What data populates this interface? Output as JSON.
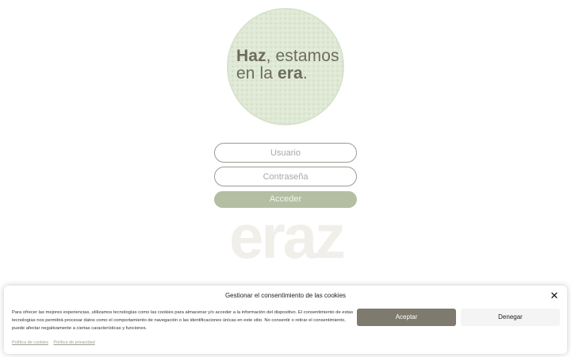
{
  "hero": {
    "line1_bold": "Haz",
    "line1_rest": ", estamos",
    "line2_start": "en la ",
    "line2_bold": "era",
    "line2_end": "."
  },
  "login": {
    "user_placeholder": "Usuario",
    "pass_placeholder": "Contraseña",
    "submit_label": "Acceder"
  },
  "logo": {
    "text": "eraz"
  },
  "cookie_banner": {
    "title": "Gestionar el consentimiento de las cookies",
    "body": "Para ofrecer las mejores experiencias, utilizamos tecnologías como las cookies para almacenar y/o acceder a la información del dispositivo. El consentimiento de estas tecnologías nos permitirá procesar datos como el comportamiento de navegación o las identificaciones únicas en este sitio. No consentir o retirar el consentimiento, puede afectar negativamente a ciertas características y funciones.",
    "accept_label": "Aceptar",
    "deny_label": "Denegar",
    "links": [
      "Política de cookies",
      "Política de privacidad"
    ]
  },
  "colors": {
    "accent_green": "#b3bea3",
    "accept_brown": "#7e7a6d",
    "hero_bg": "#dfe9d6"
  },
  "icons": {
    "close": "close-icon"
  }
}
